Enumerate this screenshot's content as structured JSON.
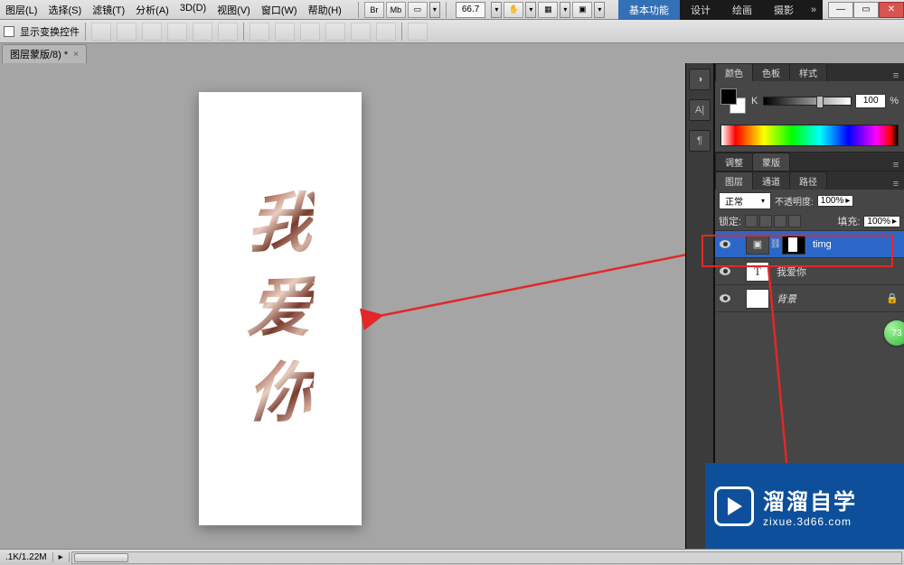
{
  "menu": {
    "items": [
      "图层(L)",
      "选择(S)",
      "滤镜(T)",
      "分析(A)",
      "3D(D)",
      "视图(V)",
      "窗口(W)",
      "帮助(H)"
    ],
    "icon_labels": [
      "Br",
      "Mb"
    ],
    "zoom": "66.7"
  },
  "workspace_tabs": {
    "active": "基本功能",
    "others": [
      "设计",
      "绘画",
      "摄影"
    ]
  },
  "options": {
    "checkbox_label": "显示变换控件"
  },
  "document_tab": {
    "title": "图层蒙版/8) *"
  },
  "canvas": {
    "char1": "我",
    "char2": "爱",
    "char3": "你"
  },
  "status": {
    "info": ".1K/1.22M"
  },
  "color_panel": {
    "tabs": [
      "颜色",
      "色板",
      "样式"
    ],
    "channel": "K",
    "value": "100",
    "pct": "%"
  },
  "adjust_panel": {
    "tabs": [
      "调整",
      "蒙版"
    ]
  },
  "layers_panel": {
    "tabs": [
      "图层",
      "通道",
      "路径"
    ],
    "blend_mode": "正常",
    "opacity_label": "不透明度:",
    "opacity_value": "100%",
    "lock_label": "锁定:",
    "fill_label": "填充:",
    "fill_value": "100%",
    "layers": [
      {
        "name": "timg",
        "selected": true,
        "type": "smart-mask"
      },
      {
        "name": "我爱你",
        "selected": false,
        "type": "text"
      },
      {
        "name": "背景",
        "selected": false,
        "type": "bg"
      }
    ]
  },
  "badge": "73",
  "watermark": {
    "title": "溜溜自学",
    "url": "zixue.3d66.com"
  }
}
